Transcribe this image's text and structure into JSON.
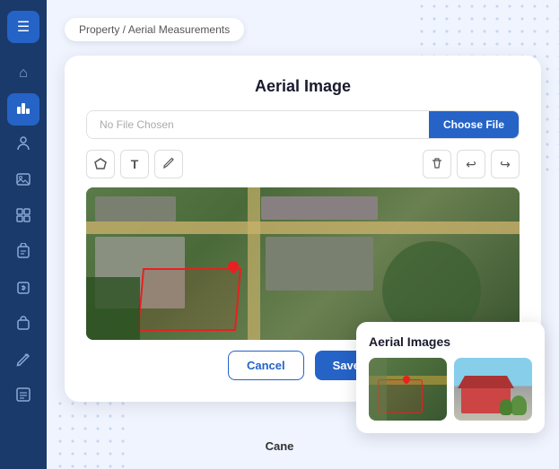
{
  "sidebar": {
    "icons": [
      {
        "name": "menu-icon",
        "symbol": "☰",
        "active": false
      },
      {
        "name": "home-icon",
        "symbol": "⌂",
        "active": false
      },
      {
        "name": "chart-icon",
        "symbol": "📊",
        "active": true
      },
      {
        "name": "person-icon",
        "symbol": "👤",
        "active": false
      },
      {
        "name": "image-icon",
        "symbol": "🖼",
        "active": false
      },
      {
        "name": "grid-icon",
        "symbol": "⊞",
        "active": false
      },
      {
        "name": "clipboard-icon",
        "symbol": "📋",
        "active": false
      },
      {
        "name": "document-dollar-icon",
        "symbol": "💲",
        "active": false
      },
      {
        "name": "bag-icon",
        "symbol": "🗃",
        "active": false
      },
      {
        "name": "edit-icon",
        "symbol": "✏",
        "active": false
      },
      {
        "name": "list-icon",
        "symbol": "📄",
        "active": false
      }
    ]
  },
  "breadcrumb": {
    "text": "Property / Aerial Measurements"
  },
  "card": {
    "title": "Aerial Image",
    "file_placeholder": "No File Chosen",
    "choose_file_label": "Choose File",
    "toolbar": {
      "polygon_label": "polygon-tool",
      "text_label": "T",
      "pencil_label": "✏",
      "delete_label": "🗑",
      "undo_label": "↩",
      "redo_label": "↪"
    },
    "cancel_label": "Cancel",
    "save_label": "Save"
  },
  "aerial_popup": {
    "title": "Aerial Images",
    "thumbs": [
      {
        "type": "satellite",
        "label": "thumb1"
      },
      {
        "type": "street",
        "label": "thumb2"
      }
    ]
  },
  "cane_label": "Cane"
}
